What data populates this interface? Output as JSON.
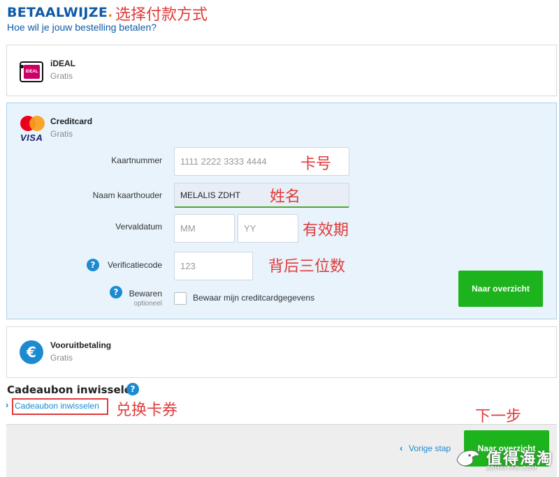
{
  "header": {
    "title": "BETAALWIJZE",
    "title_dot": ".",
    "note": "选择付款方式",
    "subtitle": "Hoe wil je jouw bestelling betalen?"
  },
  "methods": {
    "ideal": {
      "name": "iDEAL",
      "price": "Gratis",
      "logo_text": "iDEAL"
    },
    "creditcard": {
      "name": "Creditcard",
      "price": "Gratis",
      "logo_text": "VISA"
    },
    "vooruit": {
      "name": "Vooruitbetaling",
      "price": "Gratis",
      "icon_text": "€"
    }
  },
  "form": {
    "card_number": {
      "label": "Kaartnummer",
      "placeholder": "1111 2222 3333 4444",
      "note": "卡号"
    },
    "holder": {
      "label": "Naam kaarthouder",
      "value": "MELALIS ZDHT",
      "note": "姓名"
    },
    "expiry": {
      "label": "Vervaldatum",
      "mm_placeholder": "MM",
      "yy_placeholder": "YY",
      "note": "有效期"
    },
    "cvc": {
      "label": "Verificatiecode",
      "placeholder": "123",
      "note": "背后三位数"
    },
    "save": {
      "label": "Bewaren",
      "sublabel": "optioneel",
      "checkbox_label": "Bewaar mijn creditcardgegevens"
    },
    "help_icon_text": "?",
    "submit_label": "Naar overzicht"
  },
  "gift": {
    "title": "Cadeaubon inwisselen",
    "link": "Cadeaubon inwisselen",
    "note": "兑换卡券",
    "help_icon_text": "?"
  },
  "footer": {
    "prev_label": "Vorige stap",
    "next_label": "Naar overzicht",
    "note": "下一步"
  },
  "watermark": {
    "text": "值得海淘",
    "sub": "ZDHAITAO.COM"
  },
  "colors": {
    "brand_blue": "#0d5aa7",
    "accent_orange": "#f28c00",
    "green": "#1db31d",
    "annotation_red": "#e03a3a",
    "panel_active": "#e8f3fb"
  }
}
